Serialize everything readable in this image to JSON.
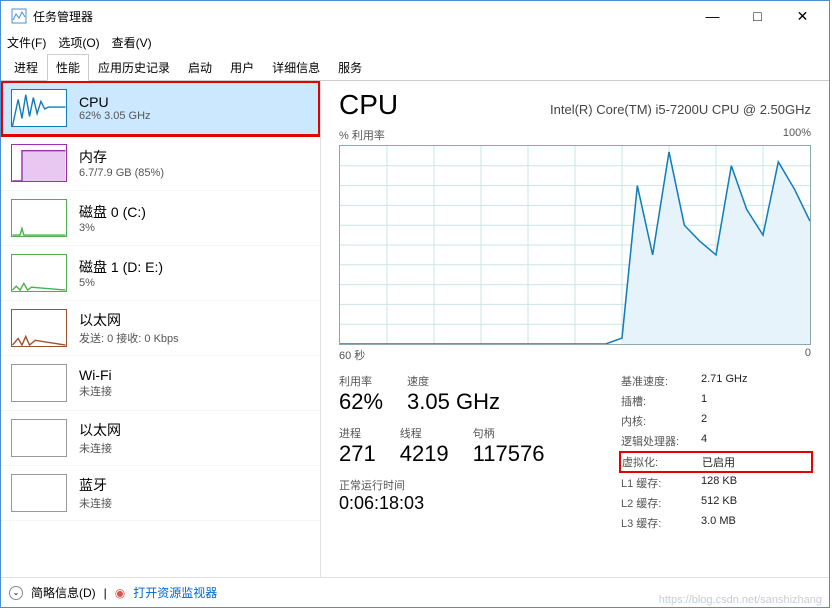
{
  "window": {
    "title": "任务管理器",
    "controls": {
      "min": "—",
      "max": "□",
      "close": "✕"
    }
  },
  "menu": {
    "file": "文件(F)",
    "options": "选项(O)",
    "view": "查看(V)"
  },
  "tabs": {
    "t0": "进程",
    "t1": "性能",
    "t2": "应用历史记录",
    "t3": "启动",
    "t4": "用户",
    "t5": "详细信息",
    "t6": "服务"
  },
  "sidebar": {
    "cpu": {
      "name": "CPU",
      "sub": "62% 3.05 GHz",
      "border": "#117dbb"
    },
    "mem": {
      "name": "内存",
      "sub": "6.7/7.9 GB (85%)",
      "border": "#9b2fae"
    },
    "disk0": {
      "name": "磁盘 0 (C:)",
      "sub": "3%",
      "border": "#4caf50"
    },
    "disk1": {
      "name": "磁盘 1 (D: E:)",
      "sub": "5%",
      "border": "#4caf50"
    },
    "eth0": {
      "name": "以太网",
      "sub": "发送: 0  接收: 0 Kbps",
      "border": "#a0522d"
    },
    "wifi": {
      "name": "Wi-Fi",
      "sub": "未连接",
      "border": "#999"
    },
    "eth1": {
      "name": "以太网",
      "sub": "未连接",
      "border": "#999"
    },
    "bt": {
      "name": "蓝牙",
      "sub": "未连接",
      "border": "#999"
    }
  },
  "detail": {
    "title": "CPU",
    "model": "Intel(R) Core(TM) i5-7200U CPU @ 2.50GHz",
    "y_label": "% 利用率",
    "y_max": "100%",
    "x_left": "60 秒",
    "x_right": "0",
    "util_lbl": "利用率",
    "util_val": "62%",
    "speed_lbl": "速度",
    "speed_val": "3.05 GHz",
    "proc_lbl": "进程",
    "proc_val": "271",
    "thread_lbl": "线程",
    "thread_val": "4219",
    "handle_lbl": "句柄",
    "handle_val": "117576",
    "uptime_lbl": "正常运行时间",
    "uptime_val": "0:06:18:03",
    "base_lbl": "基准速度:",
    "base_val": "2.71 GHz",
    "sockets_lbl": "插槽:",
    "sockets_val": "1",
    "cores_lbl": "内核:",
    "cores_val": "2",
    "lproc_lbl": "逻辑处理器:",
    "lproc_val": "4",
    "virt_lbl": "虚拟化:",
    "virt_val": "已启用",
    "l1_lbl": "L1 缓存:",
    "l1_val": "128 KB",
    "l2_lbl": "L2 缓存:",
    "l2_val": "512 KB",
    "l3_lbl": "L3 缓存:",
    "l3_val": "3.0 MB"
  },
  "chart_data": {
    "type": "area",
    "title": "% 利用率",
    "xlabel": "60 秒 → 0",
    "ylabel": "% 利用率",
    "ylim": [
      0,
      100
    ],
    "x": [
      0,
      2,
      4,
      6,
      8,
      10,
      12,
      14,
      16,
      18,
      20,
      22,
      24,
      26,
      28,
      30,
      32,
      34,
      36,
      38,
      40,
      42,
      44,
      46,
      48,
      50,
      52,
      54,
      56,
      58,
      60
    ],
    "values": [
      0,
      0,
      0,
      0,
      0,
      0,
      0,
      0,
      0,
      0,
      0,
      0,
      0,
      0,
      0,
      0,
      0,
      0,
      3,
      80,
      45,
      97,
      60,
      52,
      45,
      90,
      68,
      55,
      92,
      78,
      62
    ]
  },
  "footer": {
    "brief": "简略信息(D)",
    "resmon": "打开资源监视器"
  },
  "watermark": "https://blog.csdn.net/sanshizhang"
}
